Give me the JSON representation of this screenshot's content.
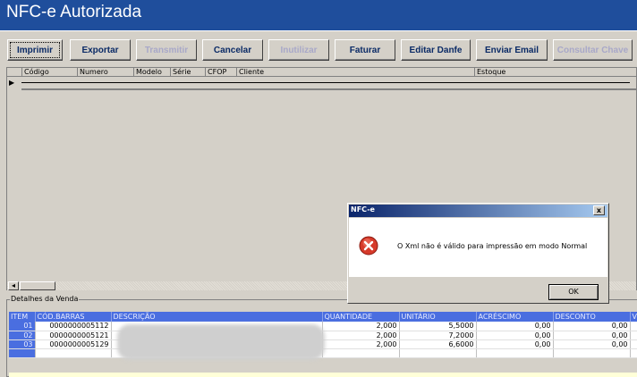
{
  "window": {
    "title": "NFC-e Autorizada"
  },
  "toolbar": {
    "buttons": [
      {
        "label": "Imprimir",
        "enabled": true
      },
      {
        "label": "Exportar",
        "enabled": true
      },
      {
        "label": "Transmitir",
        "enabled": false
      },
      {
        "label": "Cancelar",
        "enabled": true
      },
      {
        "label": "Inutilizar",
        "enabled": false
      },
      {
        "label": "Faturar",
        "enabled": true
      },
      {
        "label": "Editar Danfe",
        "enabled": true
      },
      {
        "label": "Enviar Email",
        "enabled": true
      },
      {
        "label": "Consultar Chave",
        "enabled": false
      }
    ]
  },
  "grid": {
    "columns": [
      "Código",
      "Numero",
      "Modelo",
      "Série",
      "CFOP",
      "Cliente",
      "Estoque"
    ],
    "row_indicator": "▶"
  },
  "details": {
    "legend": "Detalhes da Venda",
    "columns": [
      "ITEM",
      "CÓD.BARRAS",
      "DESCRIÇÃO",
      "QUANTIDADE",
      "UNITÁRIO",
      "ACRÉSCIMO",
      "DESCONTO",
      "V"
    ],
    "rows": [
      {
        "item": "01",
        "barcode": "0000000005112",
        "description": "",
        "quantity": "2,000",
        "unit": "5,5000",
        "increase": "0,00",
        "discount": "0,00"
      },
      {
        "item": "02",
        "barcode": "0000000005121",
        "description": "",
        "quantity": "2,000",
        "unit": "7,2000",
        "increase": "0,00",
        "discount": "0,00"
      },
      {
        "item": "03",
        "barcode": "0000000005129",
        "description": "",
        "quantity": "2,000",
        "unit": "6,6000",
        "increase": "0,00",
        "discount": "0,00"
      }
    ]
  },
  "dialog": {
    "title": "NFC-e",
    "message": "O Xml não é válido para impressão em modo Normal",
    "ok_label": "OK",
    "close_label": "x",
    "icon": "error-icon"
  }
}
